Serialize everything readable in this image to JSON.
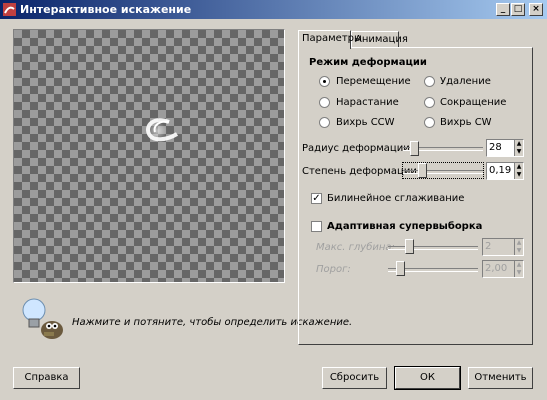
{
  "window": {
    "title": "Интерактивное искажение",
    "buttons": [
      "_",
      "□",
      "×"
    ]
  },
  "tabs": [
    {
      "label": "Параметры",
      "active": true
    },
    {
      "label": "Анимация",
      "active": false
    }
  ],
  "mode": {
    "title": "Режим деформации",
    "options": [
      {
        "label": "Перемещение",
        "checked": true
      },
      {
        "label": "Удаление",
        "checked": false
      },
      {
        "label": "Нарастание",
        "checked": false
      },
      {
        "label": "Сокращение",
        "checked": false
      },
      {
        "label": "Вихрь CCW",
        "checked": false
      },
      {
        "label": "Вихрь CW",
        "checked": false
      }
    ]
  },
  "radius": {
    "label": "Радиус деформации:",
    "value": "28"
  },
  "amount": {
    "label": "Степень деформации:",
    "value": "0,19"
  },
  "bilinear": {
    "label": "Билинейное сглаживание",
    "checked": true
  },
  "supersample": {
    "label": "Адаптивная супервыборка",
    "checked": false,
    "depth_label": "Макс. глубина:",
    "depth_value": "2",
    "threshold_label": "Порог:",
    "threshold_value": "2,00"
  },
  "hint": "Нажмите и потяните, чтобы определить искажение.",
  "buttons": {
    "help": "Справка",
    "reset": "Сбросить",
    "ok": "ОК",
    "cancel": "Отменить"
  },
  "icons": {
    "window": "warp-app-icon",
    "hint": "gimp-wilber-lightbulb-icon"
  }
}
